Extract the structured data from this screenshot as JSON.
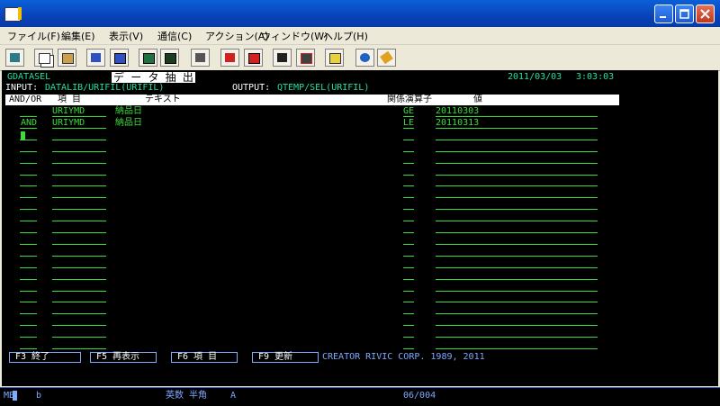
{
  "window": {
    "icon_label": "5250"
  },
  "menu": [
    {
      "label": "ファイル(F)"
    },
    {
      "label": "編集(E)"
    },
    {
      "label": "表示(V)"
    },
    {
      "label": "通信(C)"
    },
    {
      "label": "アクション(A)"
    },
    {
      "label": "ウィンドウ(W)"
    },
    {
      "label": "ヘルプ(H)"
    }
  ],
  "toolbar": {
    "buttons": [
      "print-icon",
      "copy-icon",
      "paste-icon",
      "send-icon",
      "receive-icon",
      "screen-icon",
      "display-icon",
      "keyboard-icon",
      "macro-play-icon",
      "macro-record-icon",
      "macro-stop-icon",
      "macro-edit-icon",
      "clipboard-icon",
      "globe-icon",
      "tag-icon"
    ]
  },
  "screen": {
    "program": "GDATASEL",
    "title": "デ ー タ 抽 出",
    "date": "2011/03/03",
    "time": "3:03:03",
    "input_label": "INPUT:",
    "input_value": "DATALIB/URIFIL(URIFIL)",
    "output_label": "OUTPUT:",
    "output_value": "QTEMP/SEL(URIFIL)",
    "headers": {
      "andor": "AND/OR",
      "item": "項 目",
      "text": "テキスト",
      "operator": "関係演算子",
      "value": "値"
    },
    "rows": [
      {
        "andor": "",
        "item": "URIYMD",
        "text": "納品日",
        "operator": "GE",
        "value": "20110303"
      },
      {
        "andor": "AND",
        "item": "URIYMD",
        "text": "納品日",
        "operator": "LE",
        "value": "20110313"
      }
    ],
    "fkeys": [
      {
        "label": "F3 終了"
      },
      {
        "label": "F5 再表示"
      },
      {
        "label": "F6 項 目"
      },
      {
        "label": "F9 更新"
      }
    ],
    "copyright": "CREATOR RIVIC CORP. 1989, 2011"
  },
  "status": {
    "mode": "MB",
    "session": "b",
    "input_mode": "英数 半角",
    "keyboard": "A",
    "position": "06/004"
  }
}
